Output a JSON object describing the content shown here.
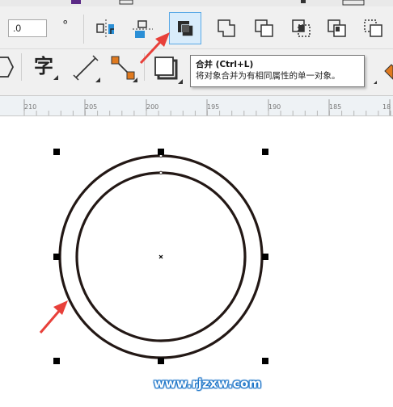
{
  "toolbar": {
    "angle_field_value": ".0",
    "degree_symbol": "°",
    "text_tool_glyph": "字",
    "combine_button": {
      "icon": "combine-icon",
      "active": true
    }
  },
  "tooltip": {
    "title": "合并 (Ctrl+L)",
    "description": "将对象合并为有相同属性的单一对象。"
  },
  "ruler": {
    "labels": [
      "210",
      "205",
      "200",
      "195",
      "190",
      "185",
      "18"
    ]
  },
  "canvas": {
    "watermark": "www.rjzxw.com",
    "outer_ring_color": "#231815",
    "arrow_color": "#e8403a",
    "selection_handle_color": "#000000"
  },
  "colors": {
    "active_button_bg": "#d9ecfb",
    "active_button_border": "#5aa9e6",
    "node_fill": "#e07a1f"
  }
}
